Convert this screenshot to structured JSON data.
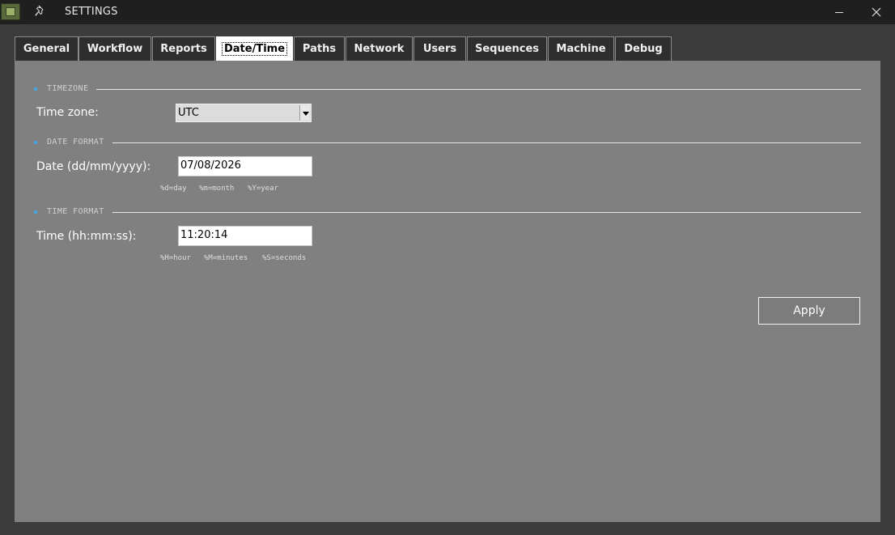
{
  "window": {
    "title": "SETTINGS",
    "icons": {
      "app": "app-icon",
      "pin": "pin-icon",
      "minimize": "minimize-icon",
      "close": "close-icon"
    }
  },
  "tabs": [
    {
      "label": "General",
      "active": false
    },
    {
      "label": "Workflow",
      "active": false
    },
    {
      "label": "Reports",
      "active": false
    },
    {
      "label": "Date/Time",
      "active": true
    },
    {
      "label": "Paths",
      "active": false
    },
    {
      "label": "Network",
      "active": false
    },
    {
      "label": "Users",
      "active": false
    },
    {
      "label": "Sequences",
      "active": false
    },
    {
      "label": "Machine",
      "active": false
    },
    {
      "label": "Debug",
      "active": false
    }
  ],
  "timezone": {
    "section_title": "TIMEZONE",
    "label": "Time zone:",
    "value": "UTC"
  },
  "date_format": {
    "section_title": "DATE FORMAT",
    "label": "Date (dd/mm/yyyy):",
    "value": "07/08/2026",
    "hints": [
      "%d=day",
      "%m=month",
      "%Y=year"
    ]
  },
  "time_format": {
    "section_title": "TIME FORMAT",
    "label": "Time (hh:mm:ss):",
    "value": "11:20:14",
    "hints": [
      "%H=hour",
      "%M=minutes",
      "%S=seconds"
    ]
  },
  "apply_label": "Apply",
  "colors": {
    "title_bar": "#1f1f1f",
    "panel": "#808080",
    "section_bullet": "#4aa3d8",
    "active_tab": "#ffffff",
    "inactive_tab": "#2e2e2e"
  }
}
